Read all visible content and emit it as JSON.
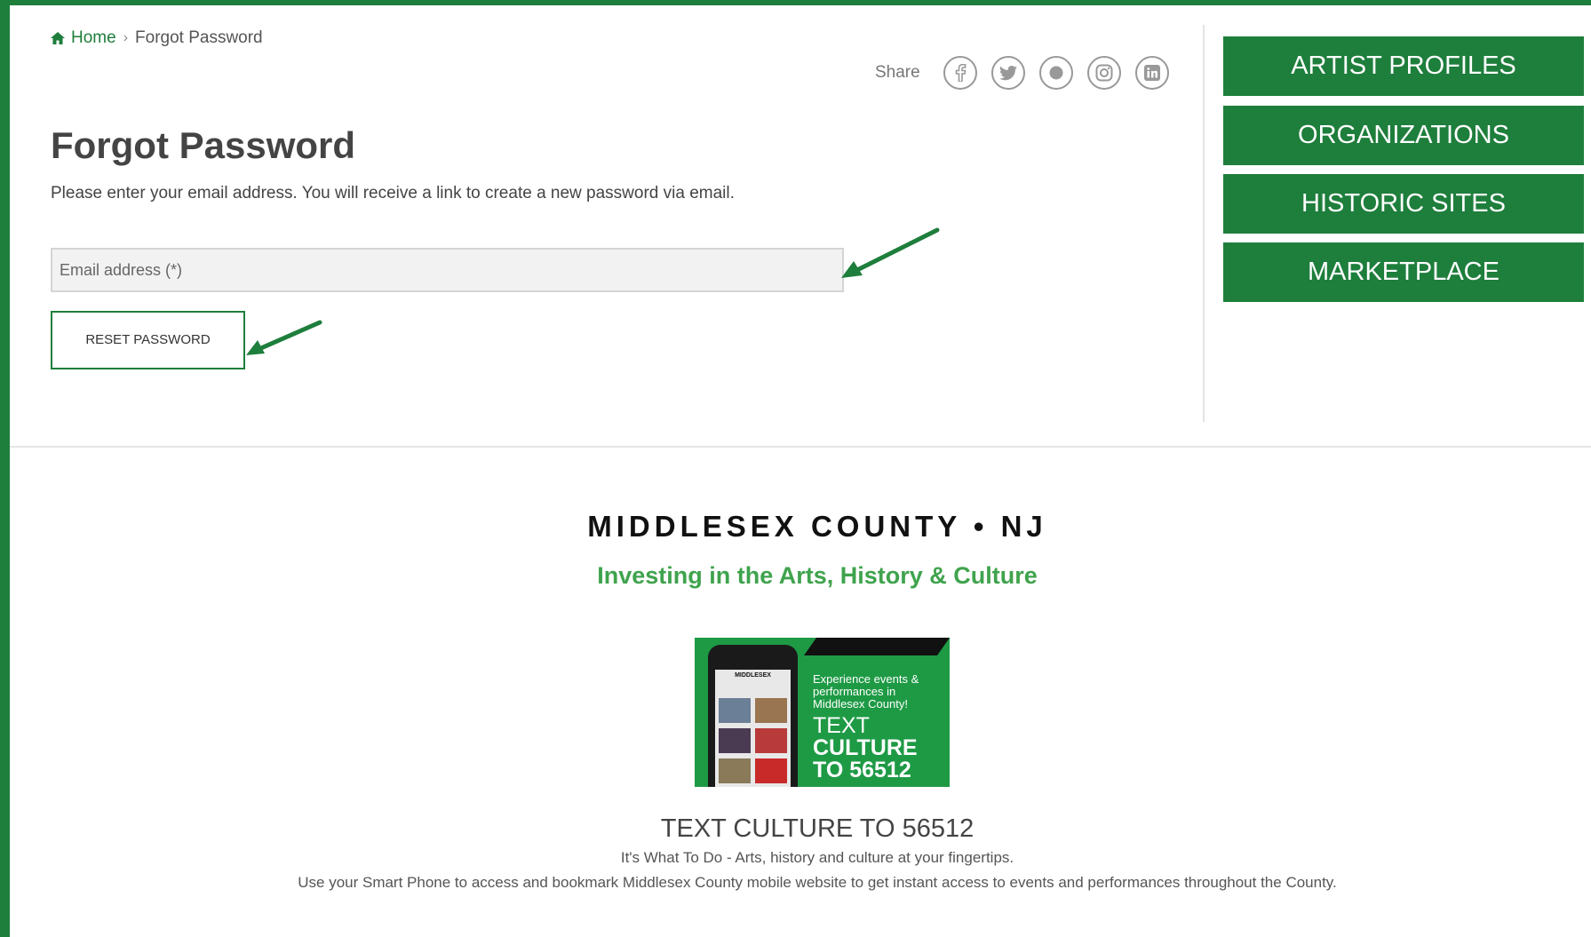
{
  "breadcrumb": {
    "home": "Home",
    "current": "Forgot Password"
  },
  "share": {
    "label": "Share",
    "icons": [
      "facebook-icon",
      "twitter-icon",
      "flickr-icon",
      "instagram-icon",
      "linkedin-icon"
    ]
  },
  "form": {
    "title": "Forgot Password",
    "intro": "Please enter your email address. You will receive a link to create a new password via email.",
    "email_placeholder": "Email address (*)",
    "email_value": "",
    "reset_label": "RESET PASSWORD"
  },
  "sidebar": {
    "items": [
      {
        "label": "ARTIST PROFILES"
      },
      {
        "label": "ORGANIZATIONS"
      },
      {
        "label": "HISTORIC SITES"
      },
      {
        "label": "MARKETPLACE"
      }
    ]
  },
  "footer": {
    "county_name": "MIDDLESEX COUNTY • NJ",
    "tagline": "Investing in the Arts, History & Culture",
    "promo": {
      "phone_brand": "MIDDLESEX",
      "small_text": "Experience events & performances in Middlesex County!",
      "line1": "TEXT",
      "line2": "CULTURE",
      "line3": "TO 56512"
    },
    "title": "TEXT CULTURE TO 56512",
    "subtitle": "It's What To Do - Arts, history and culture at your fingertips.",
    "description": "Use your Smart Phone to access and bookmark Middlesex County mobile website to get instant access to events and performances throughout the County."
  },
  "colors": {
    "brand_green": "#1e7e3c",
    "accent_green": "#3fa34d"
  }
}
